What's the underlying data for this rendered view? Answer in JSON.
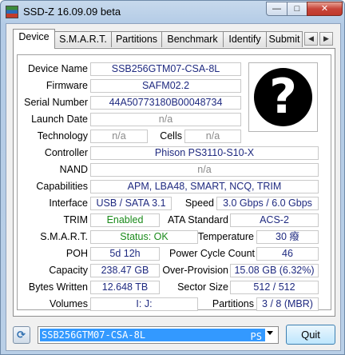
{
  "window": {
    "title": "SSD-Z 16.09.09 beta",
    "minimize": "—",
    "maximize": "□",
    "close": "✕"
  },
  "tabs": [
    {
      "label": "Device",
      "active": true
    },
    {
      "label": "S.M.A.R.T."
    },
    {
      "label": "Partitions"
    },
    {
      "label": "Benchmark"
    },
    {
      "label": "Identify"
    },
    {
      "label": "Submit"
    }
  ],
  "tab_scroll": {
    "left": "◀",
    "right": "▶"
  },
  "device_image": {
    "icon": "question-mark-icon",
    "glyph": "?"
  },
  "fields": {
    "device_name": {
      "label": "Device Name",
      "value": "SSB256GTM07-CSA-8L"
    },
    "firmware": {
      "label": "Firmware",
      "value": "SAFM02.2"
    },
    "serial_number": {
      "label": "Serial Number",
      "value": "44A50773180B00048734"
    },
    "launch_date": {
      "label": "Launch Date",
      "value": "n/a"
    },
    "technology": {
      "label": "Technology",
      "value": "n/a"
    },
    "cells": {
      "label": "Cells",
      "value": "n/a"
    },
    "controller": {
      "label": "Controller",
      "value": "Phison PS3110-S10-X"
    },
    "nand": {
      "label": "NAND",
      "value": "n/a"
    },
    "capabilities": {
      "label": "Capabilities",
      "value": "APM, LBA48, SMART, NCQ, TRIM"
    },
    "interface": {
      "label": "Interface",
      "value": "USB / SATA 3.1"
    },
    "speed": {
      "label": "Speed",
      "value": "3.0 Gbps / 6.0 Gbps"
    },
    "trim": {
      "label": "TRIM",
      "value": "Enabled"
    },
    "ata_standard": {
      "label": "ATA Standard",
      "value": "ACS-2"
    },
    "smart": {
      "label": "S.M.A.R.T.",
      "value": "Status: OK"
    },
    "temperature": {
      "label": "Temperature",
      "value": "30 癈"
    },
    "poh": {
      "label": "POH",
      "value": "5d 12h"
    },
    "power_cycle_count": {
      "label": "Power Cycle Count",
      "value": "46"
    },
    "capacity": {
      "label": "Capacity",
      "value": "238.47 GB"
    },
    "over_provision": {
      "label": "Over-Provision",
      "value": "15.08 GB (6.32%)"
    },
    "bytes_written": {
      "label": "Bytes Written",
      "value": "12.648 TB"
    },
    "sector_size": {
      "label": "Sector Size",
      "value": "512 / 512"
    },
    "volumes": {
      "label": "Volumes",
      "value": "I:  J:"
    },
    "partitions": {
      "label": "Partitions",
      "value": "3 / 8 (MBR)"
    }
  },
  "bottom": {
    "refresh_icon": "refresh-icon",
    "device_select": {
      "selected": "SSB256GTM07-CSA-8L",
      "trailing": "PS"
    },
    "quit_label": "Quit"
  },
  "colors": {
    "value_text": "#1f2a80",
    "enabled_green": "#1a8a1a",
    "selection_blue": "#3399ff"
  }
}
